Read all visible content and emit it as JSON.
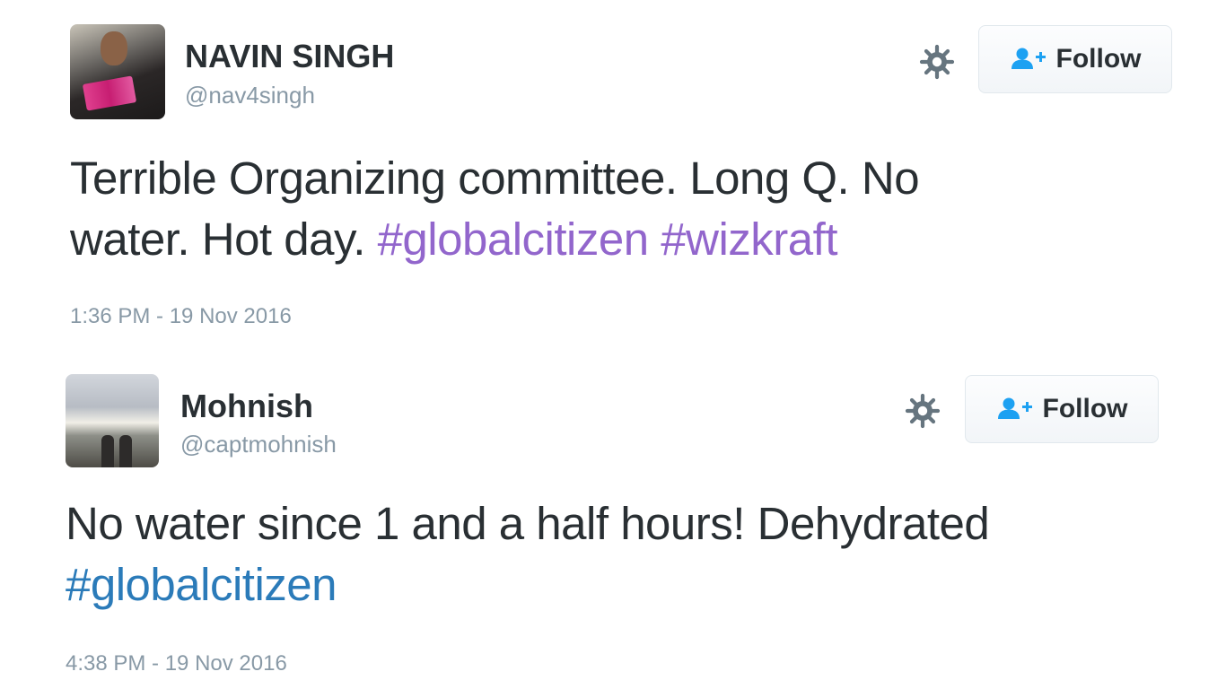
{
  "tweets": [
    {
      "display_name": "NAVIN SINGH",
      "handle": "@nav4singh",
      "follow_label": "Follow",
      "text_before": "Terrible Organizing committee. Long Q. No",
      "text_line2": "water. Hot day. ",
      "hashtags": [
        "#globalcitizen",
        "#wizkraft"
      ],
      "timestamp": "1:36 PM - 19 Nov 2016",
      "hashtag_color": "#9266cc"
    },
    {
      "display_name": "Mohnish",
      "handle": "@captmohnish",
      "follow_label": "Follow",
      "text_before": "No water since 1 and a half hours! Dehydrated",
      "hashtags": [
        "#globalcitizen"
      ],
      "timestamp": "4:38 PM - 19 Nov 2016",
      "hashtag_color": "#2b7bb9"
    }
  ],
  "icons": {
    "settings": "gear-icon",
    "follow": "follow-person-plus-icon"
  },
  "colors": {
    "text": "#292f33",
    "muted": "#8899a6",
    "follow_icon": "#1da1f2"
  }
}
